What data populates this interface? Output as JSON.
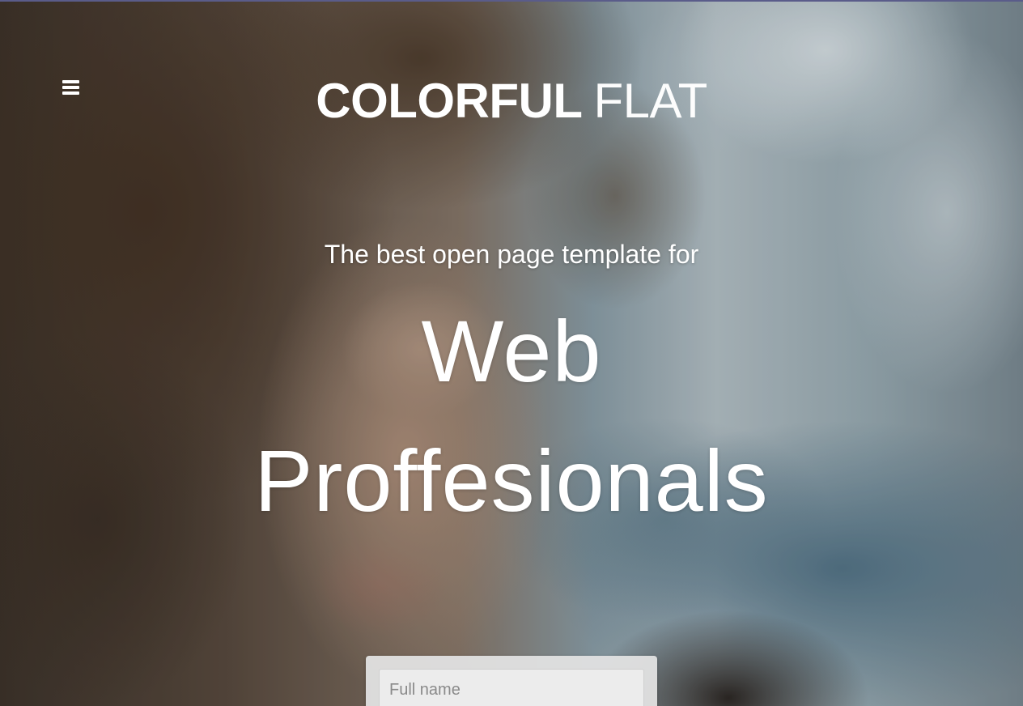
{
  "header": {
    "menu_icon": "bars-icon",
    "brand_bold": "COLORFUL",
    "brand_light": "FLAT"
  },
  "hero": {
    "tagline": "The best open page template for",
    "headline_line1": "Web",
    "headline_line2": "Proffesionals"
  },
  "signup_form": {
    "full_name_placeholder": "Full name",
    "full_name_value": ""
  },
  "colors": {
    "text": "#ffffff",
    "panel_background": "#e1e1e1",
    "input_background": "#ececec"
  }
}
